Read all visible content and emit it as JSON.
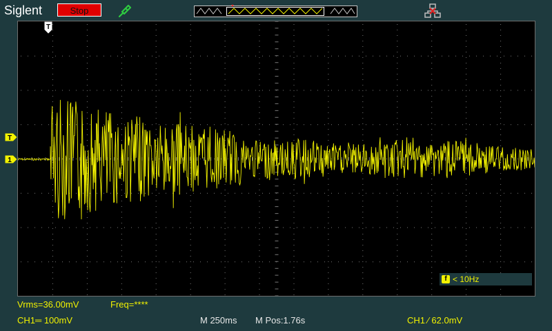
{
  "header": {
    "brand": "Siglent",
    "run_state": "Stop",
    "run_state_color": "#e00000",
    "trigger_marker": "T"
  },
  "icons": {
    "probe": "probe-icon",
    "memory": "waveform-memory-bar",
    "network": "network-icon"
  },
  "screen": {
    "trace_color": "#f2f200",
    "grid_color": "#7a7a7a",
    "trigger_pos_label": "T",
    "trig_level_label": "T",
    "ch1_label": "1"
  },
  "measurements": {
    "vrms": "Vrms=36.00mV",
    "freq": "Freq=****"
  },
  "freq_counter": {
    "badge": "f",
    "value": "< 10Hz"
  },
  "status": {
    "ch1_scale": "CH1═ 100mV",
    "timebase": "M 250ms",
    "mpos": "M Pos:1.76s",
    "trigger": "CH1 ∕ 62.0mV"
  }
}
